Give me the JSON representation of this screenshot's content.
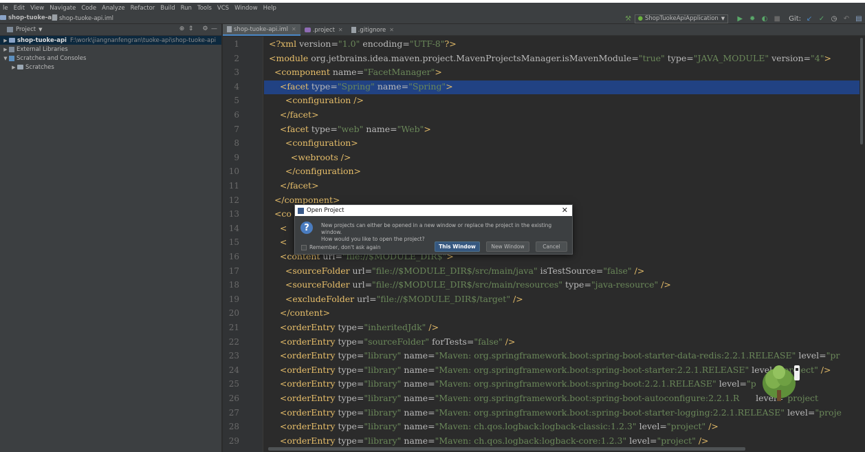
{
  "menu": [
    "le",
    "Edit",
    "View",
    "Navigate",
    "Code",
    "Analyze",
    "Refactor",
    "Build",
    "Run",
    "Tools",
    "VCS",
    "Window",
    "Help"
  ],
  "nav": {
    "project": "shop-tuoke-api",
    "file": "shop-tuoke-api.iml",
    "run_config": "ShopTuokeApiApplication",
    "git_label": "Git:"
  },
  "project_panel": {
    "title": "Project",
    "tree": [
      {
        "label": "shop-tuoke-api",
        "path": "F:\\work\\jiangnanfengran\\tuoke-api\\shop-tuoke-api",
        "expanded": false
      },
      {
        "label": "External Libraries",
        "expanded": false
      },
      {
        "label": "Scratches and Consoles",
        "expanded": true
      },
      {
        "label": "Scratches",
        "expanded": false
      }
    ]
  },
  "tabs": [
    {
      "label": "shop-tuoke-api.iml",
      "active": true
    },
    {
      "label": ".project",
      "active": false
    },
    {
      "label": ".gitignore",
      "active": false
    }
  ],
  "editor": {
    "highlighted_line": 4,
    "lines": [
      {
        "n": "1",
        "parts": [
          [
            "t",
            "<?xml "
          ],
          [
            "a",
            "version="
          ],
          [
            "v",
            "\"1.0\""
          ],
          [
            "a",
            " encoding="
          ],
          [
            "v",
            "\"UTF-8\""
          ],
          [
            "t",
            "?>"
          ]
        ]
      },
      {
        "n": "2",
        "parts": [
          [
            "t",
            "<module "
          ],
          [
            "a",
            "org.jetbrains.idea.maven.project.MavenProjectsManager.isMavenModule="
          ],
          [
            "v",
            "\"true\""
          ],
          [
            "a",
            " type="
          ],
          [
            "v",
            "\"JAVA_MODULE\""
          ],
          [
            "a",
            " version="
          ],
          [
            "v",
            "\"4\""
          ],
          [
            "t",
            ">"
          ]
        ]
      },
      {
        "n": "3",
        "parts": [
          [
            "t",
            "  <component "
          ],
          [
            "a",
            "name="
          ],
          [
            "v",
            "\"FacetManager\""
          ],
          [
            "t",
            ">"
          ]
        ]
      },
      {
        "n": "4",
        "parts": [
          [
            "t",
            "    <facet "
          ],
          [
            "a",
            "type="
          ],
          [
            "v",
            "\"Spring\""
          ],
          [
            "a",
            " name="
          ],
          [
            "v",
            "\"Spring\""
          ],
          [
            "t",
            ">"
          ]
        ]
      },
      {
        "n": "5",
        "parts": [
          [
            "t",
            "      <configuration />"
          ]
        ]
      },
      {
        "n": "6",
        "parts": [
          [
            "t",
            "    </facet>"
          ]
        ]
      },
      {
        "n": "7",
        "parts": [
          [
            "t",
            "    <facet "
          ],
          [
            "a",
            "type="
          ],
          [
            "v",
            "\"web\""
          ],
          [
            "a",
            " name="
          ],
          [
            "v",
            "\"Web\""
          ],
          [
            "t",
            ">"
          ]
        ]
      },
      {
        "n": "8",
        "parts": [
          [
            "t",
            "      <configuration>"
          ]
        ]
      },
      {
        "n": "9",
        "parts": [
          [
            "t",
            "        <webroots />"
          ]
        ]
      },
      {
        "n": "10",
        "parts": [
          [
            "t",
            "      </configuration>"
          ]
        ]
      },
      {
        "n": "11",
        "parts": [
          [
            "t",
            "    </facet>"
          ]
        ]
      },
      {
        "n": "12",
        "parts": [
          [
            "t",
            "  </component>"
          ]
        ]
      },
      {
        "n": "13",
        "parts": [
          [
            "t",
            "  <co"
          ]
        ]
      },
      {
        "n": "14",
        "parts": [
          [
            "t",
            "    <"
          ]
        ]
      },
      {
        "n": "15",
        "parts": [
          [
            "t",
            "    <"
          ]
        ]
      },
      {
        "n": "16",
        "parts": [
          [
            "t",
            "    <content "
          ],
          [
            "a",
            "url="
          ],
          [
            "v",
            "\"file://$MODULE_DIR$\""
          ],
          [
            "t",
            ">"
          ]
        ]
      },
      {
        "n": "17",
        "parts": [
          [
            "t",
            "      <sourceFolder "
          ],
          [
            "a",
            "url="
          ],
          [
            "v",
            "\"file://$MODULE_DIR$/src/main/java\""
          ],
          [
            "a",
            " isTestSource="
          ],
          [
            "v",
            "\"false\""
          ],
          [
            "t",
            " />"
          ]
        ]
      },
      {
        "n": "18",
        "parts": [
          [
            "t",
            "      <sourceFolder "
          ],
          [
            "a",
            "url="
          ],
          [
            "v",
            "\"file://$MODULE_DIR$/src/main/resources\""
          ],
          [
            "a",
            " type="
          ],
          [
            "v",
            "\"java-resource\""
          ],
          [
            "t",
            " />"
          ]
        ]
      },
      {
        "n": "19",
        "parts": [
          [
            "t",
            "      <excludeFolder "
          ],
          [
            "a",
            "url="
          ],
          [
            "v",
            "\"file://$MODULE_DIR$/target\""
          ],
          [
            "t",
            " />"
          ]
        ]
      },
      {
        "n": "20",
        "parts": [
          [
            "t",
            "    </content>"
          ]
        ]
      },
      {
        "n": "21",
        "parts": [
          [
            "t",
            "    <orderEntry "
          ],
          [
            "a",
            "type="
          ],
          [
            "v",
            "\"inheritedJdk\""
          ],
          [
            "t",
            " />"
          ]
        ]
      },
      {
        "n": "22",
        "parts": [
          [
            "t",
            "    <orderEntry "
          ],
          [
            "a",
            "type="
          ],
          [
            "v",
            "\"sourceFolder\""
          ],
          [
            "a",
            " forTests="
          ],
          [
            "v",
            "\"false\""
          ],
          [
            "t",
            " />"
          ]
        ]
      },
      {
        "n": "23",
        "parts": [
          [
            "t",
            "    <orderEntry "
          ],
          [
            "a",
            "type="
          ],
          [
            "v",
            "\"library\""
          ],
          [
            "a",
            " name="
          ],
          [
            "v",
            "\"Maven: org.springframework.boot:spring-boot-starter-data-redis:2.2.1.RELEASE\""
          ],
          [
            "a",
            " level="
          ],
          [
            "v",
            "\"pr"
          ]
        ]
      },
      {
        "n": "24",
        "parts": [
          [
            "t",
            "    <orderEntry "
          ],
          [
            "a",
            "type="
          ],
          [
            "v",
            "\"library\""
          ],
          [
            "a",
            " name="
          ],
          [
            "v",
            "\"Maven: org.springframework.boot:spring-boot-starter:2.2.1.RELEASE\""
          ],
          [
            "a",
            " level="
          ],
          [
            "v",
            "\"project\""
          ],
          [
            "t",
            " />"
          ]
        ]
      },
      {
        "n": "25",
        "parts": [
          [
            "t",
            "    <orderEntry "
          ],
          [
            "a",
            "type="
          ],
          [
            "v",
            "\"library\""
          ],
          [
            "a",
            " name="
          ],
          [
            "v",
            "\"Maven: org.springframework.boot:spring-boot:2.2.1.RELEASE\""
          ],
          [
            "a",
            " level="
          ],
          [
            "v",
            "\"p"
          ],
          [
            "t",
            "     />"
          ]
        ]
      },
      {
        "n": "26",
        "parts": [
          [
            "t",
            "    <orderEntry "
          ],
          [
            "a",
            "type="
          ],
          [
            "v",
            "\"library\""
          ],
          [
            "a",
            " name="
          ],
          [
            "v",
            "\"Maven: org.springframework.boot:spring-boot-autoconfigure:2.2.1.R"
          ],
          [
            "a",
            "      level="
          ],
          [
            "v",
            "\"project"
          ]
        ]
      },
      {
        "n": "27",
        "parts": [
          [
            "t",
            "    <orderEntry "
          ],
          [
            "a",
            "type="
          ],
          [
            "v",
            "\"library\""
          ],
          [
            "a",
            " name="
          ],
          [
            "v",
            "\"Maven: org.springframework.boot:spring-boot-starter-logging:2.2.1.RELEASE\""
          ],
          [
            "a",
            " level="
          ],
          [
            "v",
            "\"proje"
          ]
        ]
      },
      {
        "n": "28",
        "parts": [
          [
            "t",
            "    <orderEntry "
          ],
          [
            "a",
            "type="
          ],
          [
            "v",
            "\"library\""
          ],
          [
            "a",
            " name="
          ],
          [
            "v",
            "\"Maven: ch.qos.logback:logback-classic:1.2.3\""
          ],
          [
            "a",
            " level="
          ],
          [
            "v",
            "\"project\""
          ],
          [
            "t",
            " />"
          ]
        ]
      },
      {
        "n": "29",
        "parts": [
          [
            "t",
            "    <orderEntry "
          ],
          [
            "a",
            "type="
          ],
          [
            "v",
            "\"library\""
          ],
          [
            "a",
            " name="
          ],
          [
            "v",
            "\"Maven: ch.qos.logback:logback-core:1.2.3\""
          ],
          [
            "a",
            " level="
          ],
          [
            "v",
            "\"project\""
          ],
          [
            "t",
            " />"
          ]
        ]
      }
    ]
  },
  "dialog": {
    "title": "Open Project",
    "message_line1": "New projects can either be opened in a new window or replace the project in the existing window.",
    "message_line2": "How would you like to open the project?",
    "checkbox_label": "Remember, don't ask again",
    "btn_this_window": "This Window",
    "btn_new_window": "New Window",
    "btn_cancel": "Cancel"
  },
  "colors": {
    "tag": "#e8bf6a",
    "attr": "#bababa",
    "value": "#6a8759",
    "selection": "#214283",
    "primary_button": "#365880"
  }
}
